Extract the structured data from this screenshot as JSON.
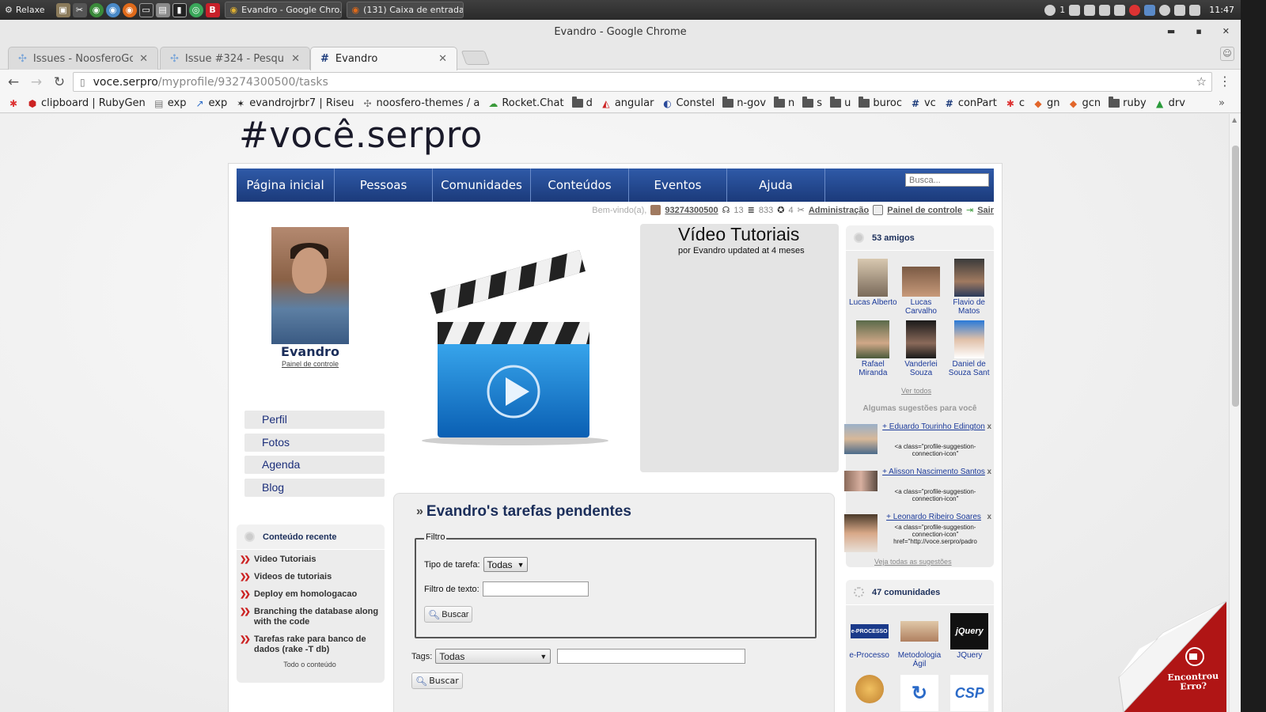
{
  "taskbar": {
    "start_label": "Relaxe",
    "windows": [
      {
        "label": "Evandro - Google Chro..."
      },
      {
        "label": "(131) Caixa de entrada..."
      }
    ],
    "tray_count": "1",
    "clock": "11:47"
  },
  "window": {
    "title": "Evandro - Google Chrome"
  },
  "tabs": [
    {
      "label": "Issues - NoosferoGov"
    },
    {
      "label": "Issue #324 - Pesquisa"
    },
    {
      "label": "Evandro"
    }
  ],
  "address": {
    "host": "voce.serpro",
    "path": "/myprofile/93274300500/tasks"
  },
  "bookmarks": [
    {
      "label": "clipboard | RubyGen"
    },
    {
      "label": "exp"
    },
    {
      "label": "exp"
    },
    {
      "label": "evandrojrbr7 | Riseu"
    },
    {
      "label": "noosfero-themes / a"
    },
    {
      "label": "Rocket.Chat"
    },
    {
      "label": "d"
    },
    {
      "label": "angular"
    },
    {
      "label": "Constel"
    },
    {
      "label": "n-gov"
    },
    {
      "label": "n"
    },
    {
      "label": "s"
    },
    {
      "label": "u"
    },
    {
      "label": "buroc"
    },
    {
      "label": "vc"
    },
    {
      "label": "conPart"
    },
    {
      "label": "c"
    },
    {
      "label": "gn"
    },
    {
      "label": "gcn"
    },
    {
      "label": "ruby"
    },
    {
      "label": "drv"
    }
  ],
  "site": {
    "title": "#você.serpro"
  },
  "nav": {
    "items": [
      "Página inicial",
      "Pessoas",
      "Comunidades",
      "Conteúdos",
      "Eventos",
      "Ajuda"
    ],
    "search_placeholder": "Busca..."
  },
  "userbar": {
    "welcome": "Bem-vindo(a),",
    "user": "93274300500",
    "count1": "13",
    "count2": "833",
    "count3": "4",
    "admin": "Administração",
    "panel": "Painel de controle",
    "logout": "Sair"
  },
  "profile": {
    "name": "Evandro",
    "panel_link": "Painel de controle",
    "menu": [
      "Perfil",
      "Fotos",
      "Agenda",
      "Blog"
    ]
  },
  "recent": {
    "title": "Conteúdo recente",
    "items": [
      "Video Tutoriais",
      "Videos de tutoriais",
      "Deploy em homologacao",
      "Branching the database along with the code",
      "Tarefas rake para banco de dados (rake -T db)"
    ],
    "all": "Todo o conteúdo"
  },
  "video": {
    "title": "Vídeo Tutoriais",
    "subtitle": "por Evandro updated at 4 meses"
  },
  "tasks": {
    "title": "Evandro's tarefas pendentes",
    "filter_legend": "Filtro",
    "type_label": "Tipo de tarefa:",
    "type_value": "Todas",
    "text_label": "Filtro de texto:",
    "search_btn": "Buscar",
    "tags_label": "Tags:",
    "tags_value": "Todas"
  },
  "friends": {
    "title": "53 amigos",
    "list": [
      {
        "name": "Lucas Alberto"
      },
      {
        "name": "Lucas Carvalho"
      },
      {
        "name": "Flavio de Matos"
      },
      {
        "name": "Rafael Miranda"
      },
      {
        "name": "Vanderlei Souza"
      },
      {
        "name": "Daniel de Souza Sant"
      }
    ],
    "see_all": "Ver todos",
    "suggestions_title": "Algumas sugestões para você",
    "suggestions": [
      {
        "name": "+ Eduardo Tourinho Edington",
        "code": "<a class=\"profile-suggestion-connection-icon\""
      },
      {
        "name": "+ Alisson Nascimento Santos",
        "code": "<a class=\"profile-suggestion-connection-icon\""
      },
      {
        "name": "+ Leonardo Ribeiro Soares",
        "code": "<a class=\"profile-suggestion-connection-icon\" href=\"http://voce.serpro/padro"
      }
    ],
    "remove": "x",
    "all_suggestions": "Veja todas as sugestões"
  },
  "communities": {
    "title": "47 comunidades",
    "list": [
      {
        "name": "e-Processo",
        "logo": "e-PROCESSO"
      },
      {
        "name": "Metodologia Ágil",
        "logo": ""
      },
      {
        "name": "JQuery",
        "logo": "jQuery"
      }
    ]
  },
  "feedback": {
    "label": "Encontrou Erro?"
  },
  "colors": {
    "nav_blue": "#1b3a7a",
    "link_blue": "#1b3a9a",
    "feedback_red": "#b01515"
  }
}
